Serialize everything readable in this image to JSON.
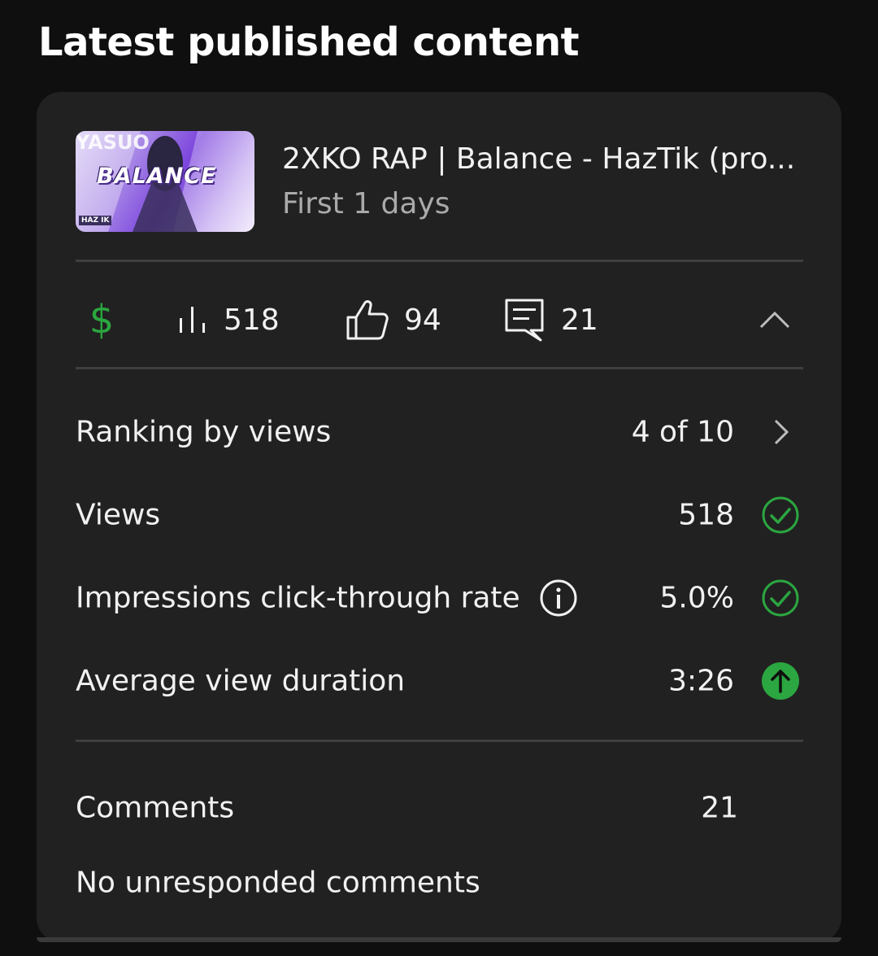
{
  "section_title": "Latest published content",
  "video": {
    "title": "2XKO RAP | Balance - HazTik (pro...",
    "subtitle": "First 1 days",
    "thumbnail_text": {
      "main": "BALANCE",
      "corner_top": "YASUO",
      "corner_bottom": "HAZ IK"
    }
  },
  "stats_bar": {
    "icons": [
      "dollar-icon",
      "bar-chart-icon",
      "thumbs-up-icon",
      "comment-icon",
      "chevron-up-icon"
    ],
    "views": "518",
    "likes": "94",
    "comments": "21"
  },
  "metrics": [
    {
      "label": "Ranking by views",
      "value": "4 of 10",
      "icon": "chevron-right-icon"
    },
    {
      "label": "Views",
      "value": "518",
      "icon": "check-circle-icon"
    },
    {
      "label": "Impressions click-through rate",
      "value": "5.0%",
      "icon": "check-circle-icon"
    },
    {
      "label": "Average view duration",
      "value": "3:26",
      "icon": "arrow-up-circle-icon"
    }
  ],
  "comments": {
    "label": "Comments",
    "count": "21",
    "status": "No unresponded comments"
  },
  "colors": {
    "accent_green": "#2ba640",
    "card_bg": "#212121",
    "page_bg": "#0f0f0f"
  }
}
